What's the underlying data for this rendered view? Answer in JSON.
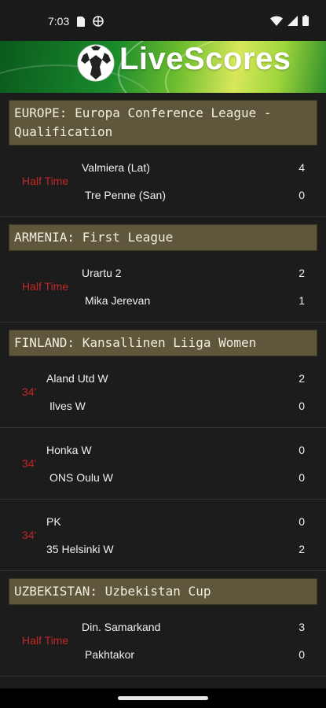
{
  "status_bar": {
    "time": "7:03"
  },
  "app": {
    "name": "LiveScores"
  },
  "leagues": [
    {
      "title": "EUROPE: Europa Conference League - Qualification",
      "matches": [
        {
          "status": "Half Time",
          "home": "Valmiera (Lat)",
          "away": "Tre Penne (San)",
          "home_score": "4",
          "away_score": "0"
        }
      ]
    },
    {
      "title": "ARMENIA: First League",
      "matches": [
        {
          "status": "Half Time",
          "home": "Urartu 2",
          "away": "Mika Jerevan",
          "home_score": "2",
          "away_score": "1"
        }
      ]
    },
    {
      "title": "FINLAND: Kansallinen Liiga Women",
      "matches": [
        {
          "status": "34'",
          "home": "Aland Utd W",
          "away": "Ilves W",
          "home_score": "2",
          "away_score": "0"
        },
        {
          "status": "34'",
          "home": "Honka W",
          "away": "ONS Oulu W",
          "home_score": "0",
          "away_score": "0"
        },
        {
          "status": "34'",
          "home": "PK",
          "away": "35 Helsinki W",
          "home_score": "0",
          "away_score": "2"
        }
      ]
    },
    {
      "title": "UZBEKISTAN: Uzbekistan Cup",
      "matches": [
        {
          "status": "Half Time",
          "home": "Din. Samarkand",
          "away": "Pakhtakor",
          "home_score": "3",
          "away_score": "0"
        }
      ]
    }
  ],
  "colors": {
    "league_header_bg": "#5e573c",
    "live_status": "#c02828",
    "background": "#1c1c1c"
  }
}
